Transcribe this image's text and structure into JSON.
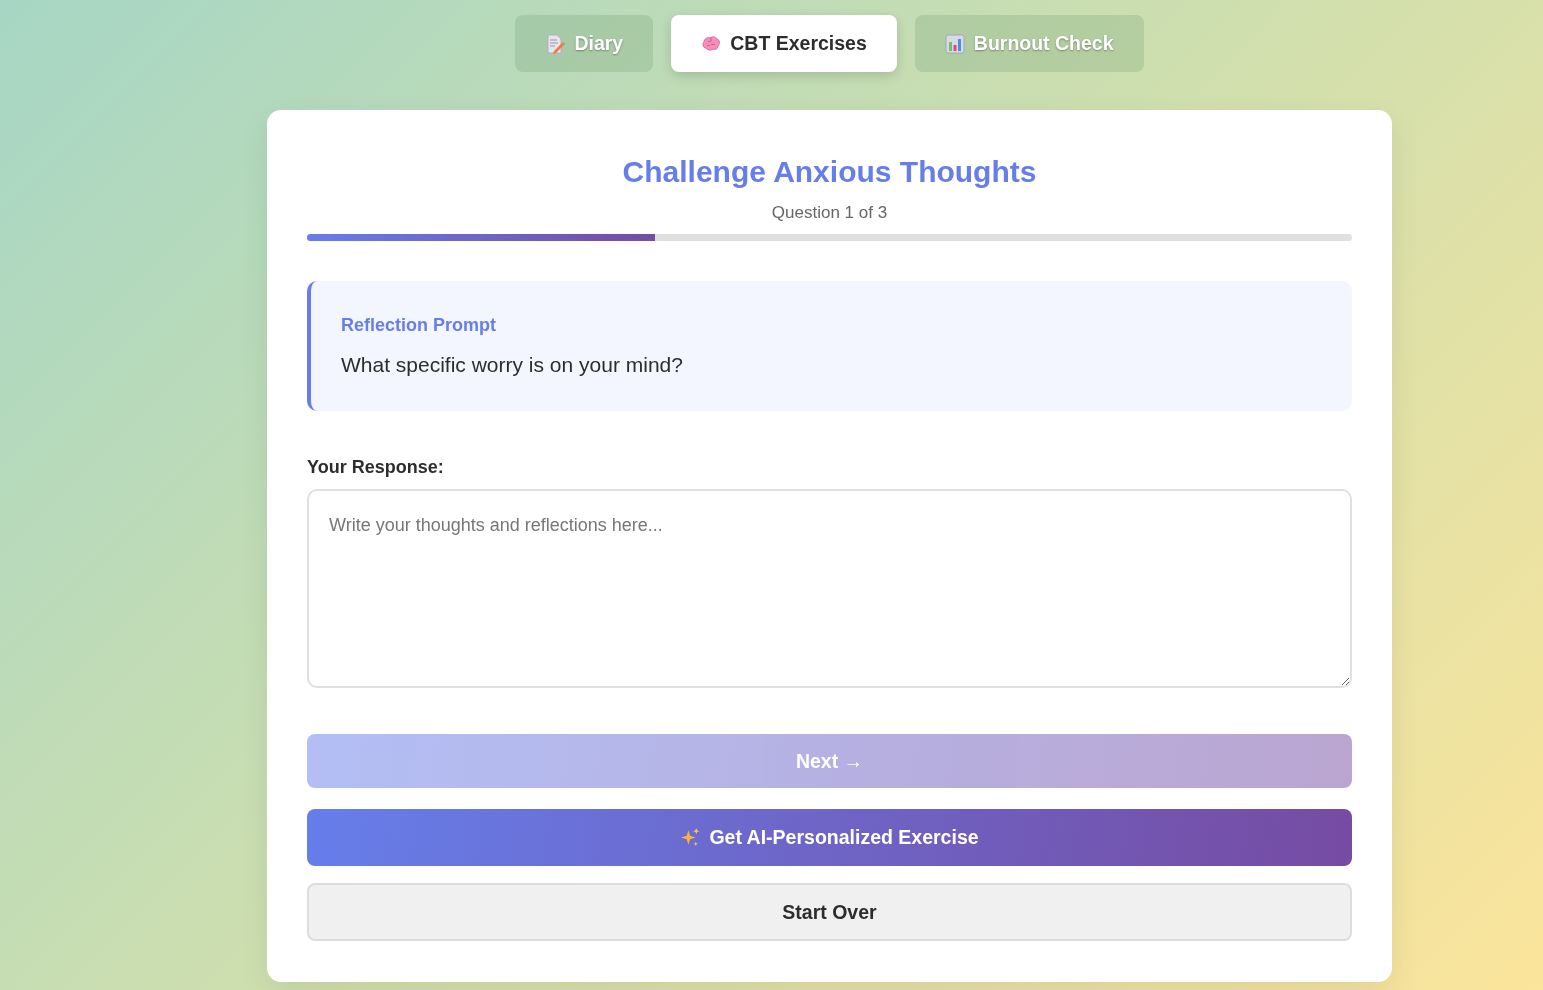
{
  "tabs": [
    {
      "label": "Diary",
      "selected": false
    },
    {
      "label": "CBT Exercises",
      "selected": true
    },
    {
      "label": "Burnout Check",
      "selected": false
    }
  ],
  "exercise": {
    "title": "Challenge Anxious Thoughts",
    "progress_text": "Question 1 of 3",
    "progress": {
      "level": 0.333
    }
  },
  "prompt": {
    "label": "Reflection Prompt",
    "question": "What specific worry is on your mind?"
  },
  "response": {
    "label": "Your Response:",
    "placeholder": "Write your thoughts and reflections here..."
  },
  "buttons": [
    {
      "kind": "next",
      "label": "Next →",
      "disabled": true
    },
    {
      "kind": "ai",
      "label": "Get AI-Personalized Exercise",
      "disabled": false
    },
    {
      "kind": "reset",
      "label": "Start Over",
      "disabled": false
    }
  ]
}
